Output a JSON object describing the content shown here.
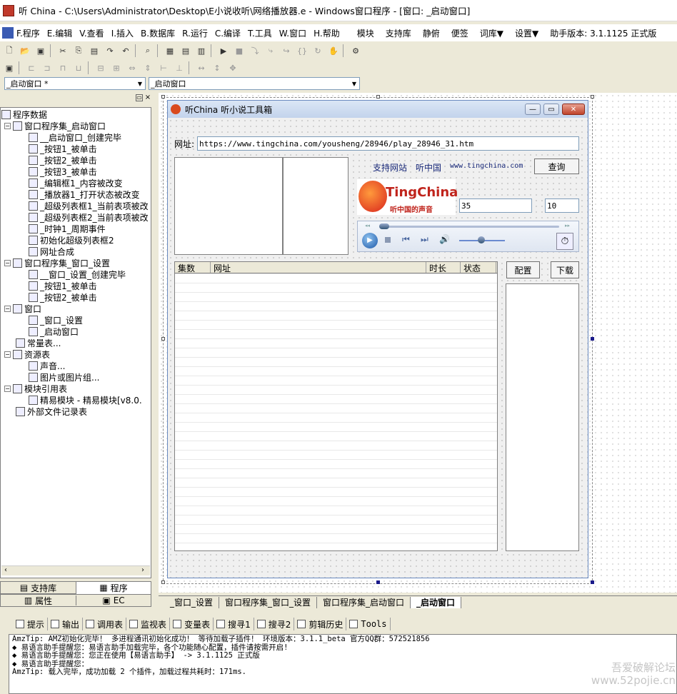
{
  "window": {
    "title": "听 China - C:\\Users\\Administrator\\Desktop\\E小说收听\\网络播放器.e - Windows窗口程序 - [窗口: _启动窗口]"
  },
  "menu": {
    "items": [
      "F.程序",
      "E.编辑",
      "V.查看",
      "I.插入",
      "B.数据库",
      "R.运行",
      "C.编译",
      "T.工具",
      "W.窗口",
      "H.帮助"
    ],
    "extra": [
      "模块",
      "支持库",
      "静俯",
      "便签",
      "词库▼",
      "设置▼",
      "助手版本: 3.1.1125 正式版"
    ]
  },
  "combos": {
    "left": "_启动窗口 *",
    "right": "_启动窗口"
  },
  "tree": {
    "root": "程序数据",
    "group1": "窗口程序集_启动窗口",
    "items1": [
      "__启动窗口_创建完毕",
      "_按钮1_被单击",
      "_按钮2_被单击",
      "_按钮3_被单击",
      "_编辑框1_内容被改变",
      "_播放器1_打开状态被改变",
      "_超级列表框1_当前表项被改",
      "_超级列表框2_当前表项被改",
      "_时钟1_周期事件",
      "初始化超级列表框2",
      "网址合成"
    ],
    "group2": "窗口程序集_窗口_设置",
    "items2": [
      "__窗口_设置_创建完毕",
      "_按钮1_被单击",
      "_按钮2_被单击"
    ],
    "windows": "窗口",
    "winitems": [
      "_窗口_设置",
      "_启动窗口"
    ],
    "const": "常量表...",
    "res": "资源表",
    "resitems": [
      "声音...",
      "图片或图片组..."
    ],
    "modref": "模块引用表",
    "moditem": "精易模块 - 精易模块[v8.0.",
    "extfile": "外部文件记录表"
  },
  "leftTabs": {
    "support": "支持库",
    "program": "程序",
    "props": "属性",
    "ec": "EC"
  },
  "form": {
    "title": "听China  听小说工具箱",
    "url_label": "网址:",
    "url_value": "https://www.tingchina.com/yousheng/28946/play_28946_31.htm",
    "support_site": "支持网站",
    "ting_cn": "听中国",
    "ting_url": "www.tingchina.com",
    "search_btn": "查询",
    "logo_text": "TingChina",
    "logo_sub": "听中国的声音",
    "num1": "35",
    "num2": "10",
    "columns": [
      "集数",
      "网址",
      "时长",
      "状态"
    ],
    "config_btn": "配置",
    "download_btn": "下载"
  },
  "docTabs": [
    "_窗口_设置",
    "窗口程序集_窗口_设置",
    "窗口程序集_启动窗口",
    "_启动窗口"
  ],
  "outTabs": [
    "提示",
    "输出",
    "调用表",
    "监视表",
    "变量表",
    "搜寻1",
    "搜寻2",
    "剪辑历史",
    "Tools"
  ],
  "output": [
    "AmzTip: AMZ初始化完毕！ 多进程通讯初始化成功！ 等待加载子插件！ 环境版本：3.1.1_beta 官方QQ群：572521856",
    "◆ 易语言助手提醒您：易语言助手加载完毕，各个功能随心配置，插件请按需开启!",
    "◆ 易语言助手提醒您：您正在使用【易语言助手】 -> 3.1.1125 正式版",
    "◆ 易语言助手提醒您：",
    "AmzTip: 载入完毕，成功加载 2 个插件，加载过程共耗时：171ms."
  ],
  "watermark": "吾爱破解论坛\nwww.52pojie.cn"
}
